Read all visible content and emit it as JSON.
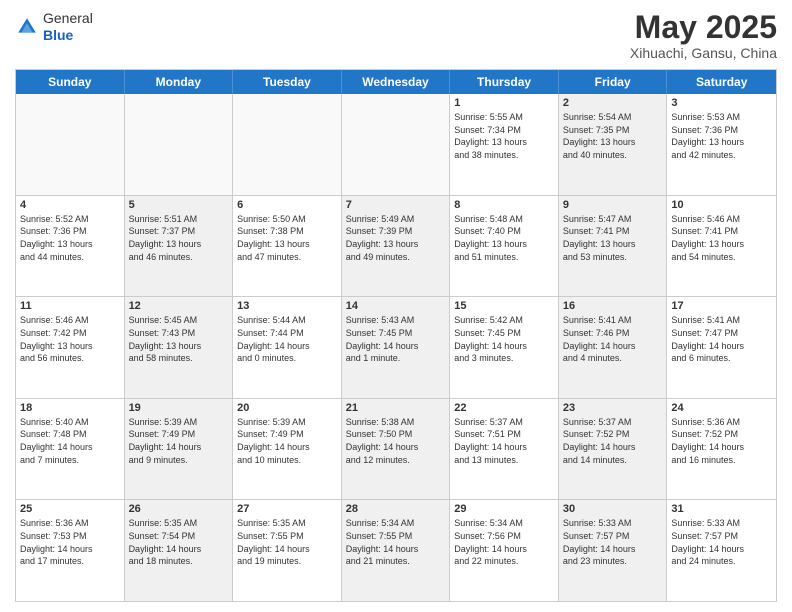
{
  "logo": {
    "general": "General",
    "blue": "Blue"
  },
  "title": "May 2025",
  "location": "Xihuachi, Gansu, China",
  "header_days": [
    "Sunday",
    "Monday",
    "Tuesday",
    "Wednesday",
    "Thursday",
    "Friday",
    "Saturday"
  ],
  "rows": [
    [
      {
        "day": "",
        "info": "",
        "empty": true
      },
      {
        "day": "",
        "info": "",
        "empty": true
      },
      {
        "day": "",
        "info": "",
        "empty": true
      },
      {
        "day": "",
        "info": "",
        "empty": true
      },
      {
        "day": "1",
        "info": "Sunrise: 5:55 AM\nSunset: 7:34 PM\nDaylight: 13 hours\nand 38 minutes.",
        "empty": false
      },
      {
        "day": "2",
        "info": "Sunrise: 5:54 AM\nSunset: 7:35 PM\nDaylight: 13 hours\nand 40 minutes.",
        "empty": false,
        "shaded": true
      },
      {
        "day": "3",
        "info": "Sunrise: 5:53 AM\nSunset: 7:36 PM\nDaylight: 13 hours\nand 42 minutes.",
        "empty": false
      }
    ],
    [
      {
        "day": "4",
        "info": "Sunrise: 5:52 AM\nSunset: 7:36 PM\nDaylight: 13 hours\nand 44 minutes.",
        "empty": false
      },
      {
        "day": "5",
        "info": "Sunrise: 5:51 AM\nSunset: 7:37 PM\nDaylight: 13 hours\nand 46 minutes.",
        "empty": false,
        "shaded": true
      },
      {
        "day": "6",
        "info": "Sunrise: 5:50 AM\nSunset: 7:38 PM\nDaylight: 13 hours\nand 47 minutes.",
        "empty": false
      },
      {
        "day": "7",
        "info": "Sunrise: 5:49 AM\nSunset: 7:39 PM\nDaylight: 13 hours\nand 49 minutes.",
        "empty": false,
        "shaded": true
      },
      {
        "day": "8",
        "info": "Sunrise: 5:48 AM\nSunset: 7:40 PM\nDaylight: 13 hours\nand 51 minutes.",
        "empty": false
      },
      {
        "day": "9",
        "info": "Sunrise: 5:47 AM\nSunset: 7:41 PM\nDaylight: 13 hours\nand 53 minutes.",
        "empty": false,
        "shaded": true
      },
      {
        "day": "10",
        "info": "Sunrise: 5:46 AM\nSunset: 7:41 PM\nDaylight: 13 hours\nand 54 minutes.",
        "empty": false
      }
    ],
    [
      {
        "day": "11",
        "info": "Sunrise: 5:46 AM\nSunset: 7:42 PM\nDaylight: 13 hours\nand 56 minutes.",
        "empty": false
      },
      {
        "day": "12",
        "info": "Sunrise: 5:45 AM\nSunset: 7:43 PM\nDaylight: 13 hours\nand 58 minutes.",
        "empty": false,
        "shaded": true
      },
      {
        "day": "13",
        "info": "Sunrise: 5:44 AM\nSunset: 7:44 PM\nDaylight: 14 hours\nand 0 minutes.",
        "empty": false
      },
      {
        "day": "14",
        "info": "Sunrise: 5:43 AM\nSunset: 7:45 PM\nDaylight: 14 hours\nand 1 minute.",
        "empty": false,
        "shaded": true
      },
      {
        "day": "15",
        "info": "Sunrise: 5:42 AM\nSunset: 7:45 PM\nDaylight: 14 hours\nand 3 minutes.",
        "empty": false
      },
      {
        "day": "16",
        "info": "Sunrise: 5:41 AM\nSunset: 7:46 PM\nDaylight: 14 hours\nand 4 minutes.",
        "empty": false,
        "shaded": true
      },
      {
        "day": "17",
        "info": "Sunrise: 5:41 AM\nSunset: 7:47 PM\nDaylight: 14 hours\nand 6 minutes.",
        "empty": false
      }
    ],
    [
      {
        "day": "18",
        "info": "Sunrise: 5:40 AM\nSunset: 7:48 PM\nDaylight: 14 hours\nand 7 minutes.",
        "empty": false
      },
      {
        "day": "19",
        "info": "Sunrise: 5:39 AM\nSunset: 7:49 PM\nDaylight: 14 hours\nand 9 minutes.",
        "empty": false,
        "shaded": true
      },
      {
        "day": "20",
        "info": "Sunrise: 5:39 AM\nSunset: 7:49 PM\nDaylight: 14 hours\nand 10 minutes.",
        "empty": false
      },
      {
        "day": "21",
        "info": "Sunrise: 5:38 AM\nSunset: 7:50 PM\nDaylight: 14 hours\nand 12 minutes.",
        "empty": false,
        "shaded": true
      },
      {
        "day": "22",
        "info": "Sunrise: 5:37 AM\nSunset: 7:51 PM\nDaylight: 14 hours\nand 13 minutes.",
        "empty": false
      },
      {
        "day": "23",
        "info": "Sunrise: 5:37 AM\nSunset: 7:52 PM\nDaylight: 14 hours\nand 14 minutes.",
        "empty": false,
        "shaded": true
      },
      {
        "day": "24",
        "info": "Sunrise: 5:36 AM\nSunset: 7:52 PM\nDaylight: 14 hours\nand 16 minutes.",
        "empty": false
      }
    ],
    [
      {
        "day": "25",
        "info": "Sunrise: 5:36 AM\nSunset: 7:53 PM\nDaylight: 14 hours\nand 17 minutes.",
        "empty": false
      },
      {
        "day": "26",
        "info": "Sunrise: 5:35 AM\nSunset: 7:54 PM\nDaylight: 14 hours\nand 18 minutes.",
        "empty": false,
        "shaded": true
      },
      {
        "day": "27",
        "info": "Sunrise: 5:35 AM\nSunset: 7:55 PM\nDaylight: 14 hours\nand 19 minutes.",
        "empty": false
      },
      {
        "day": "28",
        "info": "Sunrise: 5:34 AM\nSunset: 7:55 PM\nDaylight: 14 hours\nand 21 minutes.",
        "empty": false,
        "shaded": true
      },
      {
        "day": "29",
        "info": "Sunrise: 5:34 AM\nSunset: 7:56 PM\nDaylight: 14 hours\nand 22 minutes.",
        "empty": false
      },
      {
        "day": "30",
        "info": "Sunrise: 5:33 AM\nSunset: 7:57 PM\nDaylight: 14 hours\nand 23 minutes.",
        "empty": false,
        "shaded": true
      },
      {
        "day": "31",
        "info": "Sunrise: 5:33 AM\nSunset: 7:57 PM\nDaylight: 14 hours\nand 24 minutes.",
        "empty": false
      }
    ]
  ]
}
